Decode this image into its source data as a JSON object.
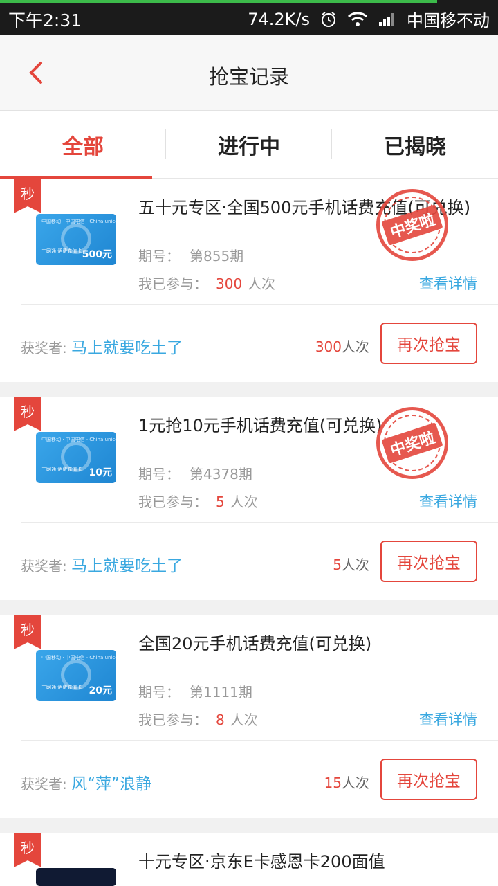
{
  "status_bar": {
    "time": "下午2:31",
    "net_speed": "74.2K/s",
    "carrier": "中国移不动",
    "icons": [
      "alarm-icon",
      "wifi-icon",
      "signal-icon"
    ]
  },
  "header": {
    "title": "抢宝记录",
    "back_icon": "chevron-left-icon"
  },
  "tabs": [
    {
      "label": "全部",
      "active": true
    },
    {
      "label": "进行中",
      "active": false
    },
    {
      "label": "已揭晓",
      "active": false
    }
  ],
  "labels": {
    "seckill_badge": "秒",
    "issue_label": "期号：",
    "joined_label": "我已参与：",
    "joined_unit": "人次",
    "detail_link": "查看详情",
    "winner_label": "获奖者:",
    "count_unit": "人次",
    "retry_button": "再次抢宝",
    "stamp_text": "中奖啦"
  },
  "records": [
    {
      "title": "五十元专区·全国500元手机话费充值(可兑换)",
      "card_amount": "500元",
      "card_text": "三网通 话费充值卡",
      "issue": "第855期",
      "joined": "300",
      "winner": "马上就要吃土了",
      "total_count": "300",
      "won": true
    },
    {
      "title": "1元抢10元手机话费充值(可兑换)",
      "card_amount": "10元",
      "card_text": "三网通 话费充值卡",
      "issue": "第4378期",
      "joined": "5",
      "winner": "马上就要吃土了",
      "total_count": "5",
      "won": true
    },
    {
      "title": "全国20元手机话费充值(可兑换)",
      "card_amount": "20元",
      "card_text": "三网通 话费充值卡",
      "issue": "第1111期",
      "joined": "8",
      "winner": "风“萍”浪静",
      "total_count": "15",
      "won": false
    },
    {
      "title": "十元专区·京东E卡感恩卡200面值",
      "won": false
    }
  ],
  "colors": {
    "accent": "#e4463c",
    "link": "#3aa8e0",
    "muted": "#999999"
  }
}
